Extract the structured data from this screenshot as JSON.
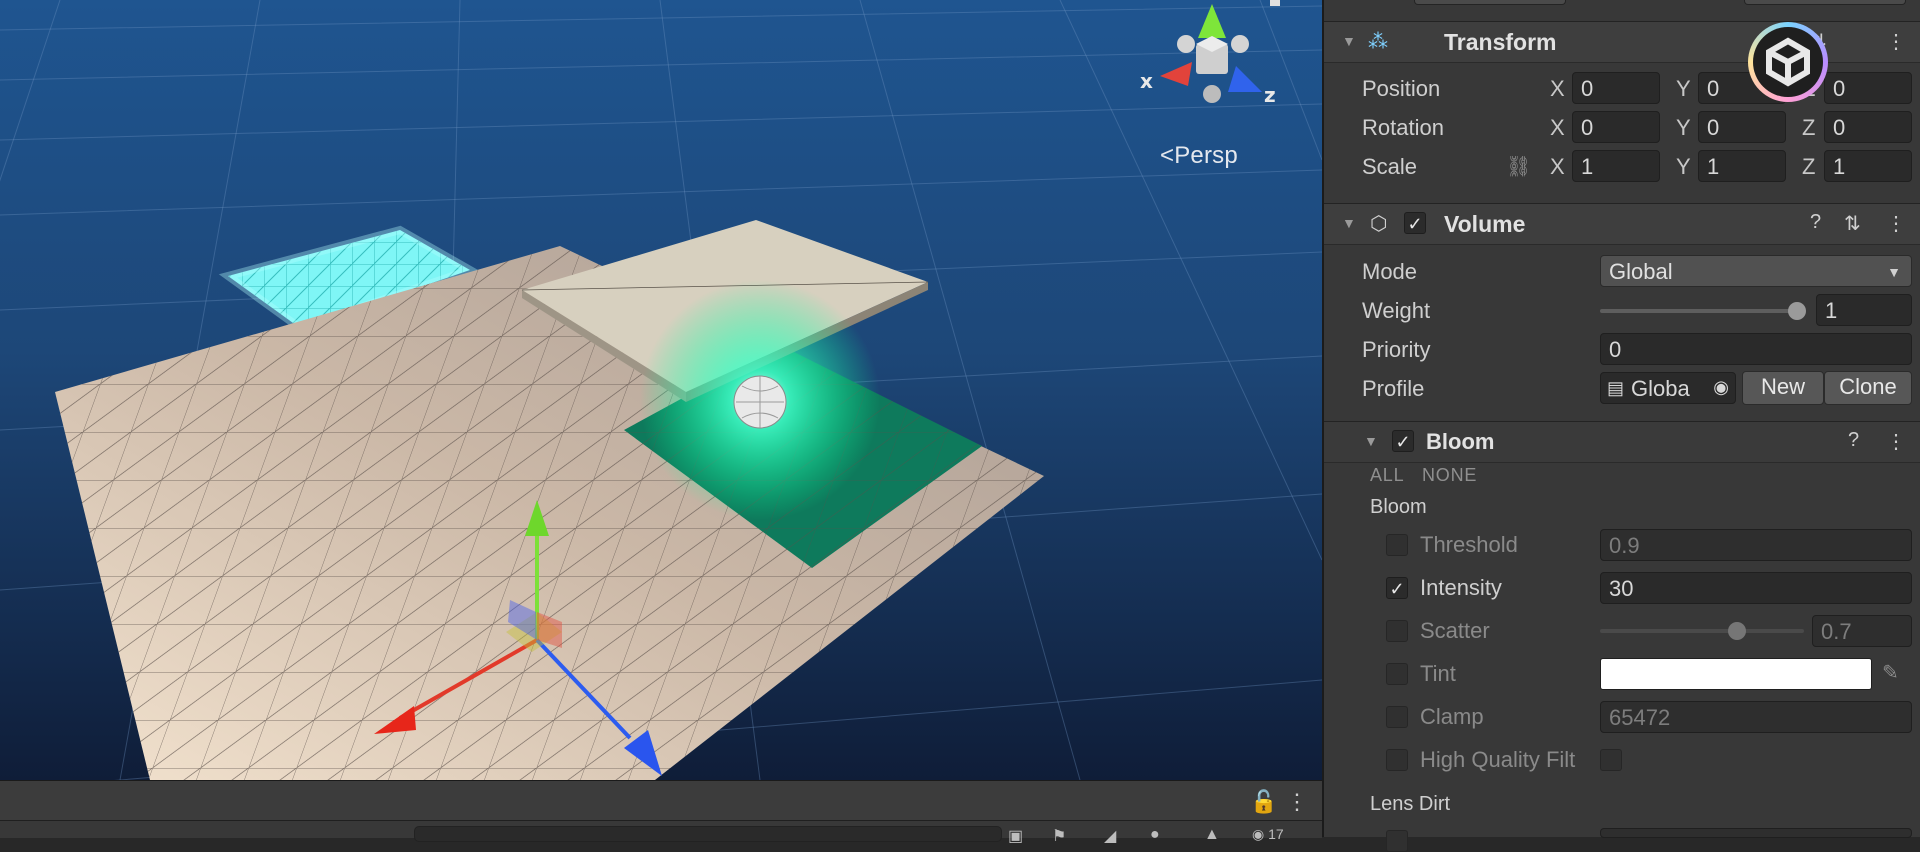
{
  "scene": {
    "view_mode": "Persp",
    "gizmo_axes": {
      "x": "x",
      "z": "z"
    }
  },
  "inspector": {
    "transform": {
      "title": "Transform",
      "position": {
        "label": "Position",
        "x": "0",
        "y": "0",
        "z": "0"
      },
      "rotation": {
        "label": "Rotation",
        "x": "0",
        "y": "0",
        "z": "0"
      },
      "scale": {
        "label": "Scale",
        "x": "1",
        "y": "1",
        "z": "1"
      },
      "axis_x": "X",
      "axis_y": "Y",
      "axis_z": "Z"
    },
    "volume": {
      "title": "Volume",
      "enabled": true,
      "mode_label": "Mode",
      "mode_value": "Global",
      "weight_label": "Weight",
      "weight_value": "1",
      "weight_fraction": 1.0,
      "priority_label": "Priority",
      "priority_value": "0",
      "profile_label": "Profile",
      "profile_value": "Globa",
      "new_label": "New",
      "clone_label": "Clone"
    },
    "bloom": {
      "title": "Bloom",
      "enabled": true,
      "all_label": "ALL",
      "none_label": "NONE",
      "section_label": "Bloom",
      "threshold_label": "Threshold",
      "threshold_value": "0.9",
      "threshold_override": false,
      "intensity_label": "Intensity",
      "intensity_value": "30",
      "intensity_override": true,
      "scatter_label": "Scatter",
      "scatter_value": "0.7",
      "scatter_fraction": 0.7,
      "scatter_override": false,
      "tint_label": "Tint",
      "tint_color": "#ffffff",
      "tint_override": false,
      "clamp_label": "Clamp",
      "clamp_value": "65472",
      "clamp_override": false,
      "hq_label": "High Quality Filt",
      "hq_override": false,
      "lens_dirt_label": "Lens Dirt"
    }
  },
  "footer": {
    "hidden_count": "17"
  },
  "colors": {
    "accent_cyan": "#6ef5f5",
    "emissive_green": "#2affb0",
    "sky": "#1d3e6c"
  }
}
